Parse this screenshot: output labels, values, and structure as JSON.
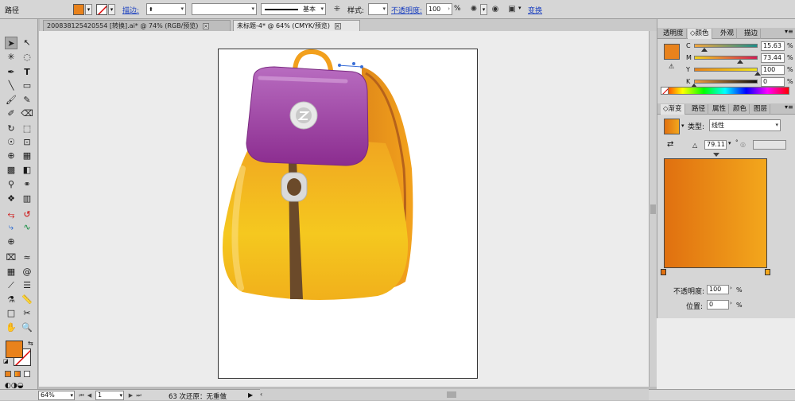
{
  "control_bar": {
    "object_type": "路径",
    "fill_color": "#e8821c",
    "stroke_label": "描边:",
    "stroke_style": "基本",
    "style_label": "样式:",
    "opacity_label": "不透明度:",
    "opacity_value": "100",
    "percent": "%",
    "transform_label": "变换"
  },
  "tabs": [
    {
      "label": "200838125420554 [转换].ai* @ 74% (RGB/预览)",
      "close": "×"
    },
    {
      "label": "未标题-4* @ 64% (CMYK/预览)",
      "close": "×"
    }
  ],
  "color_panel": {
    "tabs": [
      "透明度",
      "颜色",
      "外观",
      "描边"
    ],
    "channels": [
      {
        "label": "C",
        "value": "15.63",
        "pos": 0.16
      },
      {
        "label": "M",
        "value": "73.44",
        "pos": 0.73
      },
      {
        "label": "Y",
        "value": "100",
        "pos": 1.0
      },
      {
        "label": "K",
        "value": "0",
        "pos": 0.0
      }
    ],
    "percent": "%"
  },
  "gradient_panel": {
    "tabs": [
      "渐变",
      "路径",
      "属性",
      "颜色",
      "图层"
    ],
    "type_label": "类型:",
    "type_value": "线性",
    "angle_value": "79.11",
    "opacity_label": "不透明度:",
    "opacity_value": "100",
    "location_label": "位置:",
    "location_value": "0",
    "percent": "%",
    "color_start": "#e07010",
    "color_end": "#f3a71c"
  },
  "status_bar": {
    "zoom": "64%",
    "page": "1",
    "status_text": "63 次还原：无重做",
    "play_icon": "▶"
  },
  "colors": {
    "accent_orange": "#e8821c",
    "backpack_purple": "#9b3fa0",
    "backpack_yellow": "#f1b01b",
    "strap_brown": "#6b4a2a"
  }
}
